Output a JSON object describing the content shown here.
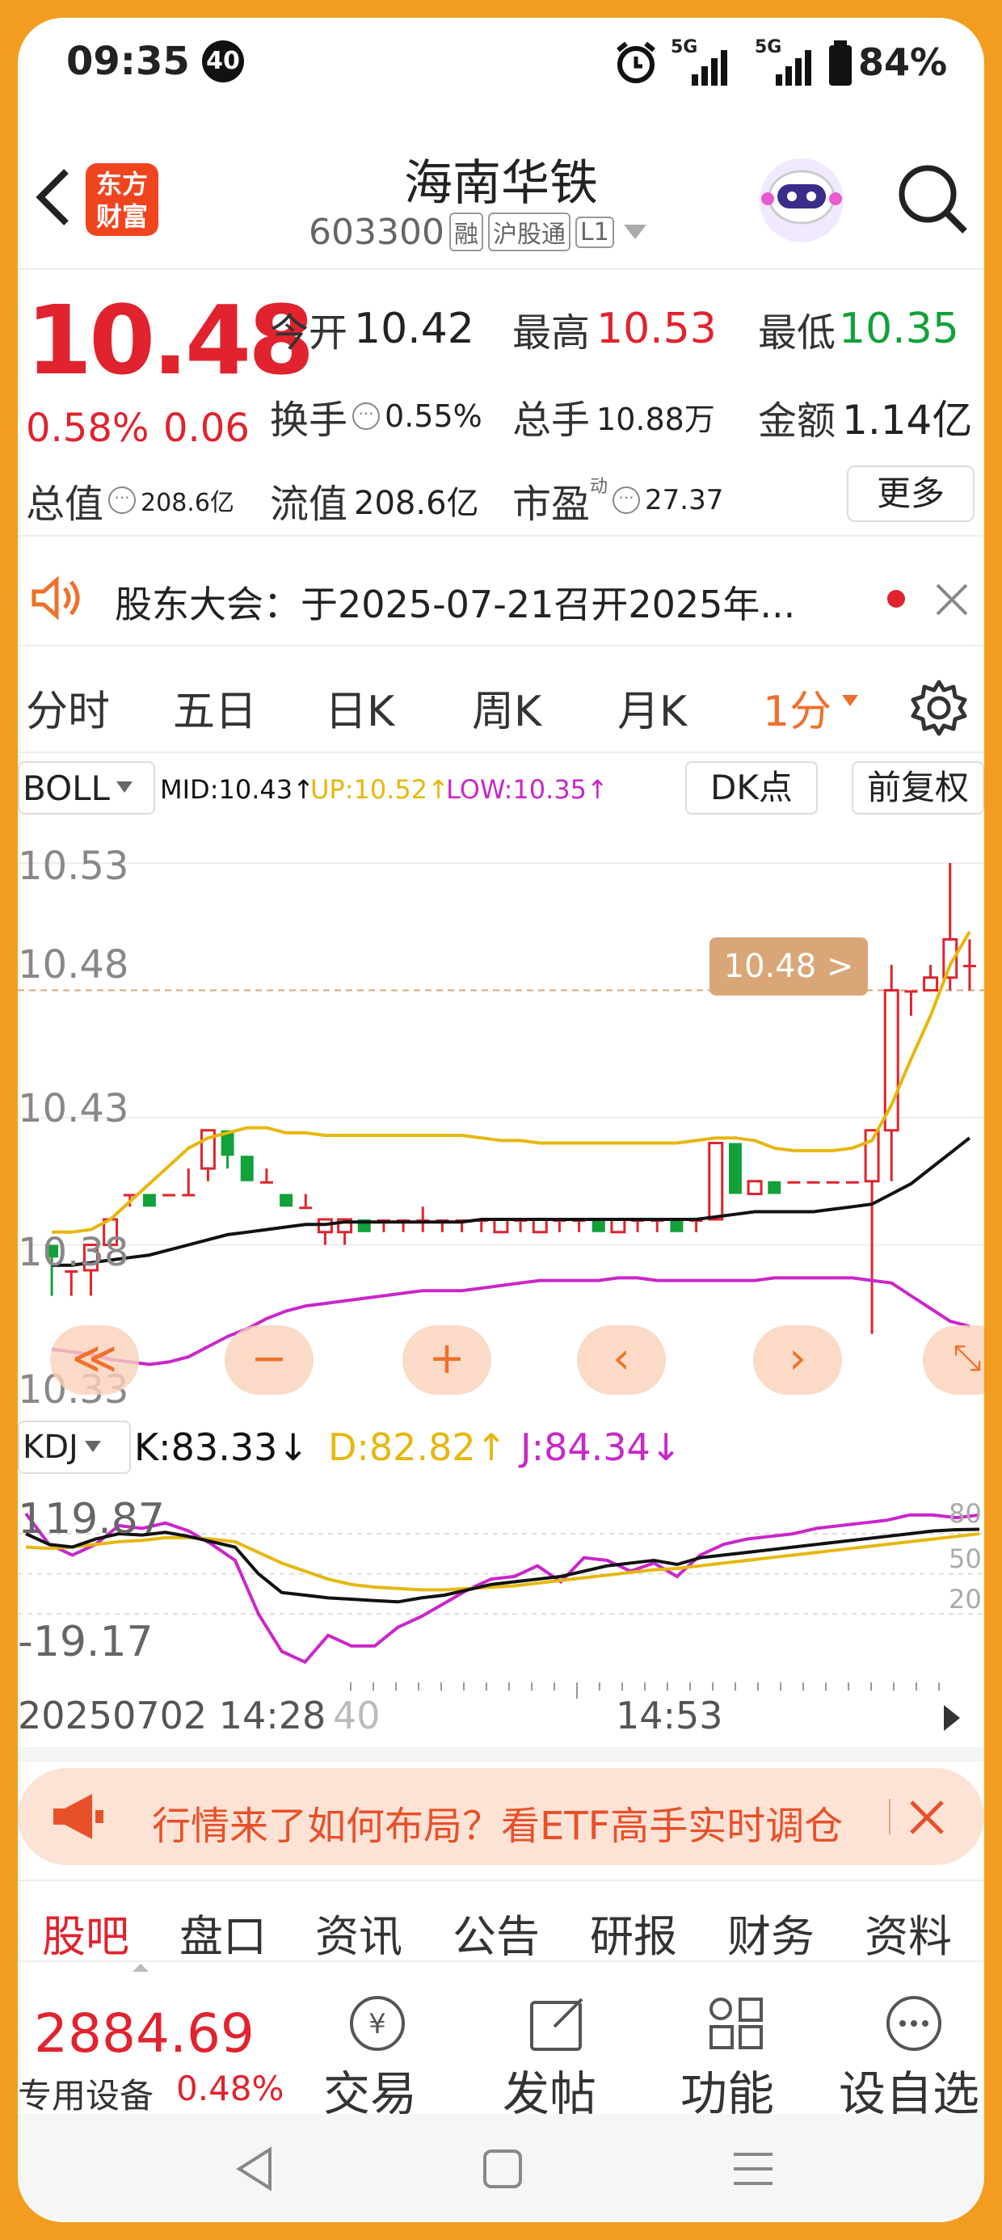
{
  "status_bar": {
    "time": "09:35",
    "notif_count": "40",
    "net1": "5G",
    "net2": "5G",
    "battery": "84%"
  },
  "header": {
    "logo_line1": "东方",
    "logo_line2": "财富",
    "stock_name": "海南华铁",
    "stock_code": "603300",
    "badges": [
      "融",
      "沪股通",
      "L1"
    ]
  },
  "quote": {
    "price": "10.48",
    "change_pct": "0.58%",
    "change": "0.06",
    "open_label": "今开",
    "open": "10.42",
    "high_label": "最高",
    "high": "10.53",
    "low_label": "最低",
    "low": "10.35",
    "turnover_label": "换手",
    "turnover": "0.55%",
    "volume_label": "总手",
    "volume": "10.88万",
    "amount_label": "金额",
    "amount": "1.14亿",
    "mktcap_label": "总值",
    "mktcap": "208.6亿",
    "float_label": "流值",
    "float_cap": "208.6亿",
    "pe_label": "市盈",
    "pe_sup": "动",
    "pe": "27.37",
    "more_button": "更多"
  },
  "notice": {
    "text": "股东大会：于2025-07-21召开2025年..."
  },
  "chart_tabs": [
    "分时",
    "五日",
    "日K",
    "周K",
    "月K",
    "1分"
  ],
  "indicator": {
    "name": "BOLL",
    "mid": "MID:10.43↑",
    "up": "UP:10.52↑",
    "low": "LOW:10.35↑",
    "dk_button": "DK点",
    "fq_button": "前复权",
    "price_tag": "10.48 >"
  },
  "price_axis": [
    "10.53",
    "10.48",
    "10.43",
    "10.38",
    "10.33"
  ],
  "kdj": {
    "name": "KDJ",
    "k": "K:83.33↓",
    "d": "D:82.82↑",
    "j": "J:84.34↓",
    "axis_top": "119.87",
    "axis_bottom": "-19.17",
    "levels": [
      "80",
      "50",
      "20"
    ]
  },
  "time_axis": {
    "date_time": "20250702 14:28",
    "faded": "40",
    "mid": "14:53"
  },
  "ad": {
    "text": "行情来了如何布局？看ETF高手实时调仓"
  },
  "bottom_tabs": [
    "股吧",
    "盘口",
    "资讯",
    "公告",
    "研报",
    "财务",
    "资料"
  ],
  "bottom_bar": {
    "index_value": "2884.69",
    "index_name": "专用设备",
    "index_change": "0.48%",
    "actions": [
      "交易",
      "发帖",
      "功能",
      "设自选"
    ]
  },
  "colors": {
    "up": "#e0232e",
    "down": "#12a13a",
    "boll_mid": "#111111",
    "boll_up": "#e6b70f",
    "boll_low": "#c927c9",
    "kdj_k": "#111111",
    "kdj_d": "#e6b70f",
    "kdj_j": "#c927c9",
    "accent": "#f29d1f"
  },
  "chart_data": {
    "type": "candlestick",
    "ylim": [
      10.33,
      10.53
    ],
    "candles": [
      {
        "o": 10.38,
        "c": 10.375,
        "h": 10.38,
        "l": 10.36
      },
      {
        "o": 10.37,
        "c": 10.37,
        "h": 10.37,
        "l": 10.36
      },
      {
        "o": 10.37,
        "c": 10.38,
        "h": 10.38,
        "l": 10.36
      },
      {
        "o": 10.38,
        "c": 10.39,
        "h": 10.39,
        "l": 10.38
      },
      {
        "o": 10.4,
        "c": 10.4,
        "h": 10.4,
        "l": 10.395
      },
      {
        "o": 10.4,
        "c": 10.395,
        "h": 10.4,
        "l": 10.395
      },
      {
        "o": 10.4,
        "c": 10.4,
        "h": 10.4,
        "l": 10.4
      },
      {
        "o": 10.4,
        "c": 10.4,
        "h": 10.41,
        "l": 10.4
      },
      {
        "o": 10.41,
        "c": 10.425,
        "h": 10.425,
        "l": 10.405
      },
      {
        "o": 10.425,
        "c": 10.415,
        "h": 10.425,
        "l": 10.41
      },
      {
        "o": 10.415,
        "c": 10.405,
        "h": 10.415,
        "l": 10.405
      },
      {
        "o": 10.405,
        "c": 10.405,
        "h": 10.41,
        "l": 10.405
      },
      {
        "o": 10.4,
        "c": 10.395,
        "h": 10.4,
        "l": 10.395
      },
      {
        "o": 10.395,
        "c": 10.395,
        "h": 10.4,
        "l": 10.395
      },
      {
        "o": 10.385,
        "c": 10.39,
        "h": 10.39,
        "l": 10.38
      },
      {
        "o": 10.385,
        "c": 10.39,
        "h": 10.39,
        "l": 10.38
      },
      {
        "o": 10.39,
        "c": 10.385,
        "h": 10.39,
        "l": 10.385
      },
      {
        "o": 10.39,
        "c": 10.39,
        "h": 10.39,
        "l": 10.385
      },
      {
        "o": 10.39,
        "c": 10.39,
        "h": 10.39,
        "l": 10.385
      },
      {
        "o": 10.39,
        "c": 10.39,
        "h": 10.395,
        "l": 10.385
      },
      {
        "o": 10.39,
        "c": 10.39,
        "h": 10.39,
        "l": 10.385
      },
      {
        "o": 10.39,
        "c": 10.39,
        "h": 10.39,
        "l": 10.385
      },
      {
        "o": 10.39,
        "c": 10.39,
        "h": 10.39,
        "l": 10.385
      },
      {
        "o": 10.385,
        "c": 10.39,
        "h": 10.39,
        "l": 10.385
      },
      {
        "o": 10.39,
        "c": 10.39,
        "h": 10.39,
        "l": 10.385
      },
      {
        "o": 10.385,
        "c": 10.39,
        "h": 10.39,
        "l": 10.385
      },
      {
        "o": 10.39,
        "c": 10.39,
        "h": 10.39,
        "l": 10.385
      },
      {
        "o": 10.39,
        "c": 10.39,
        "h": 10.39,
        "l": 10.385
      },
      {
        "o": 10.39,
        "c": 10.385,
        "h": 10.39,
        "l": 10.385
      },
      {
        "o": 10.385,
        "c": 10.39,
        "h": 10.39,
        "l": 10.385
      },
      {
        "o": 10.39,
        "c": 10.39,
        "h": 10.39,
        "l": 10.385
      },
      {
        "o": 10.39,
        "c": 10.39,
        "h": 10.39,
        "l": 10.385
      },
      {
        "o": 10.39,
        "c": 10.385,
        "h": 10.39,
        "l": 10.385
      },
      {
        "o": 10.39,
        "c": 10.39,
        "h": 10.39,
        "l": 10.385
      },
      {
        "o": 10.39,
        "c": 10.42,
        "h": 10.42,
        "l": 10.39
      },
      {
        "o": 10.42,
        "c": 10.4,
        "h": 10.42,
        "l": 10.4
      },
      {
        "o": 10.4,
        "c": 10.405,
        "h": 10.405,
        "l": 10.4
      },
      {
        "o": 10.405,
        "c": 10.4,
        "h": 10.405,
        "l": 10.4
      },
      {
        "o": 10.405,
        "c": 10.405,
        "h": 10.405,
        "l": 10.405
      },
      {
        "o": 10.405,
        "c": 10.405,
        "h": 10.405,
        "l": 10.405
      },
      {
        "o": 10.405,
        "c": 10.405,
        "h": 10.405,
        "l": 10.405
      },
      {
        "o": 10.405,
        "c": 10.405,
        "h": 10.405,
        "l": 10.405
      },
      {
        "o": 10.405,
        "c": 10.425,
        "h": 10.425,
        "l": 10.345
      },
      {
        "o": 10.425,
        "c": 10.48,
        "h": 10.49,
        "l": 10.405
      },
      {
        "o": 10.48,
        "c": 10.48,
        "h": 10.48,
        "l": 10.47
      },
      {
        "o": 10.48,
        "c": 10.485,
        "h": 10.49,
        "l": 10.48
      },
      {
        "o": 10.485,
        "c": 10.5,
        "h": 10.53,
        "l": 10.48
      },
      {
        "o": 10.49,
        "c": 10.49,
        "h": 10.5,
        "l": 10.48
      }
    ],
    "boll_up": [
      10.385,
      10.385,
      10.386,
      10.39,
      10.397,
      10.404,
      10.411,
      10.418,
      10.422,
      10.424,
      10.426,
      10.426,
      10.424,
      10.424,
      10.423,
      10.423,
      10.423,
      10.423,
      10.423,
      10.423,
      10.423,
      10.423,
      10.422,
      10.421,
      10.421,
      10.42,
      10.42,
      10.42,
      10.42,
      10.42,
      10.42,
      10.42,
      10.42,
      10.421,
      10.422,
      10.422,
      10.421,
      10.418,
      10.417,
      10.417,
      10.417,
      10.418,
      10.421,
      10.435,
      10.453,
      10.47,
      10.49,
      10.503
    ],
    "boll_mid": [
      10.372,
      10.372,
      10.373,
      10.374,
      10.375,
      10.376,
      10.378,
      10.38,
      10.382,
      10.384,
      10.385,
      10.386,
      10.387,
      10.388,
      10.388,
      10.389,
      10.389,
      10.389,
      10.389,
      10.389,
      10.389,
      10.389,
      10.39,
      10.39,
      10.39,
      10.39,
      10.39,
      10.39,
      10.39,
      10.39,
      10.39,
      10.39,
      10.39,
      10.39,
      10.391,
      10.392,
      10.393,
      10.393,
      10.393,
      10.393,
      10.394,
      10.395,
      10.396,
      10.4,
      10.404,
      10.41,
      10.416,
      10.422
    ],
    "boll_low": [
      10.339,
      10.338,
      10.337,
      10.335,
      10.334,
      10.333,
      10.334,
      10.336,
      10.34,
      10.344,
      10.347,
      10.351,
      10.354,
      10.356,
      10.357,
      10.358,
      10.359,
      10.36,
      10.361,
      10.362,
      10.362,
      10.362,
      10.363,
      10.364,
      10.365,
      10.366,
      10.366,
      10.366,
      10.366,
      10.367,
      10.367,
      10.366,
      10.366,
      10.366,
      10.366,
      10.366,
      10.366,
      10.367,
      10.367,
      10.367,
      10.367,
      10.367,
      10.366,
      10.365,
      10.36,
      10.355,
      10.35,
      10.348
    ],
    "kdj_k": [
      80,
      72,
      70,
      76,
      80,
      79,
      81,
      78,
      74,
      70,
      50,
      36,
      34,
      32,
      31,
      30,
      29,
      32,
      34,
      38,
      42,
      44,
      46,
      48,
      52,
      56,
      58,
      60,
      57,
      62,
      64,
      66,
      68,
      70,
      72,
      74,
      76,
      78,
      80,
      82,
      83,
      83.3
    ],
    "kdj_d": [
      70,
      69,
      70,
      72,
      74,
      75,
      77,
      77,
      76,
      74,
      66,
      58,
      52,
      46,
      42,
      40,
      39,
      38,
      38,
      39,
      40,
      41,
      43,
      45,
      47,
      49,
      51,
      53,
      54,
      56,
      58,
      60,
      62,
      64,
      66,
      68,
      70,
      72,
      74,
      76,
      78,
      80
    ],
    "kdj_j": [
      95,
      72,
      64,
      72,
      86,
      84,
      88,
      82,
      72,
      60,
      20,
      -8,
      -16,
      4,
      -4,
      -4,
      10,
      18,
      28,
      38,
      46,
      48,
      56,
      44,
      62,
      60,
      52,
      58,
      48,
      64,
      72,
      76,
      78,
      80,
      84,
      86,
      88,
      90,
      94,
      94,
      92,
      94
    ]
  }
}
